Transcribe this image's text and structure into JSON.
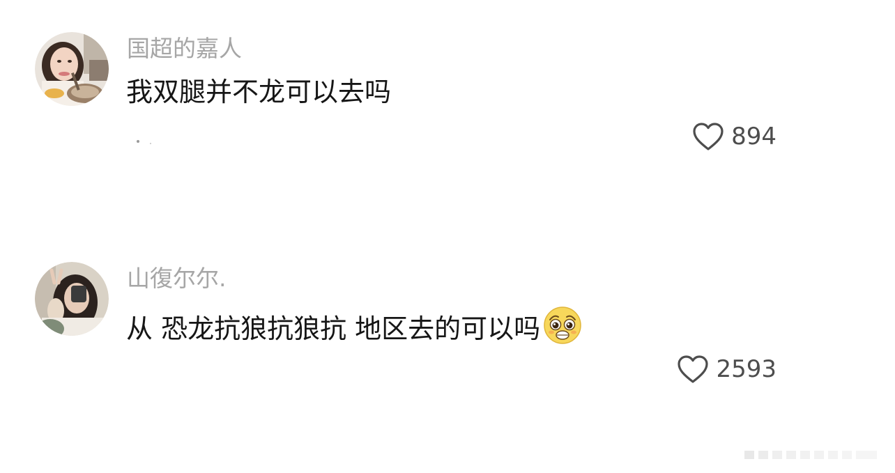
{
  "comments": [
    {
      "username": "国超的嘉人",
      "text": "我双腿并不龙可以去吗",
      "likes": "894",
      "avatar": "avatar-girl-with-food"
    },
    {
      "username": "山復尔尔.",
      "text": "从 恐龙抗狼抗狼抗 地区去的可以吗",
      "likes": "2593",
      "avatar": "avatar-girl-peace-sign",
      "emoji": "pleading-face-emoji"
    }
  ],
  "icons": {
    "like": "heart-outline-icon"
  },
  "colors": {
    "background": "#ffffff",
    "username": "#a6a6a6",
    "text": "#161616",
    "like": "#4d4d4d"
  }
}
